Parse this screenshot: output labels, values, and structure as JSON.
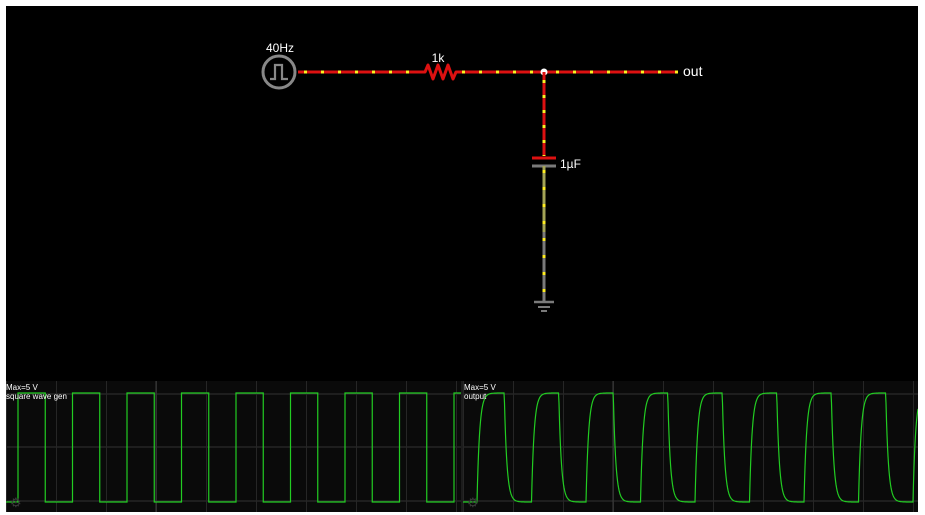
{
  "circuit": {
    "source_label": "40Hz",
    "resistor_label": "1k",
    "capacitor_label": "1µF",
    "output_label": "out",
    "source_icon": "square-wave-source-icon",
    "ground_icon": "ground-icon",
    "colors": {
      "background": "#000000",
      "wire_high": "#dd1111",
      "wire_mid": "#c46b6b",
      "wire_low": "#7a7a7a",
      "current_dots": "#ffee22",
      "text": "#ffffff"
    }
  },
  "scopes": [
    {
      "max_label": "Max=5 V",
      "name_label": "square wave gen",
      "trace_color": "#22cc22",
      "grid_color": "#333333",
      "gear_icon": "gear-icon",
      "gear_glyph": "⚙"
    },
    {
      "max_label": "Max=5 V",
      "name_label": "output",
      "trace_color": "#22cc22",
      "grid_color": "#333333",
      "gear_icon": "gear-icon",
      "gear_glyph": "⚙"
    }
  ]
}
